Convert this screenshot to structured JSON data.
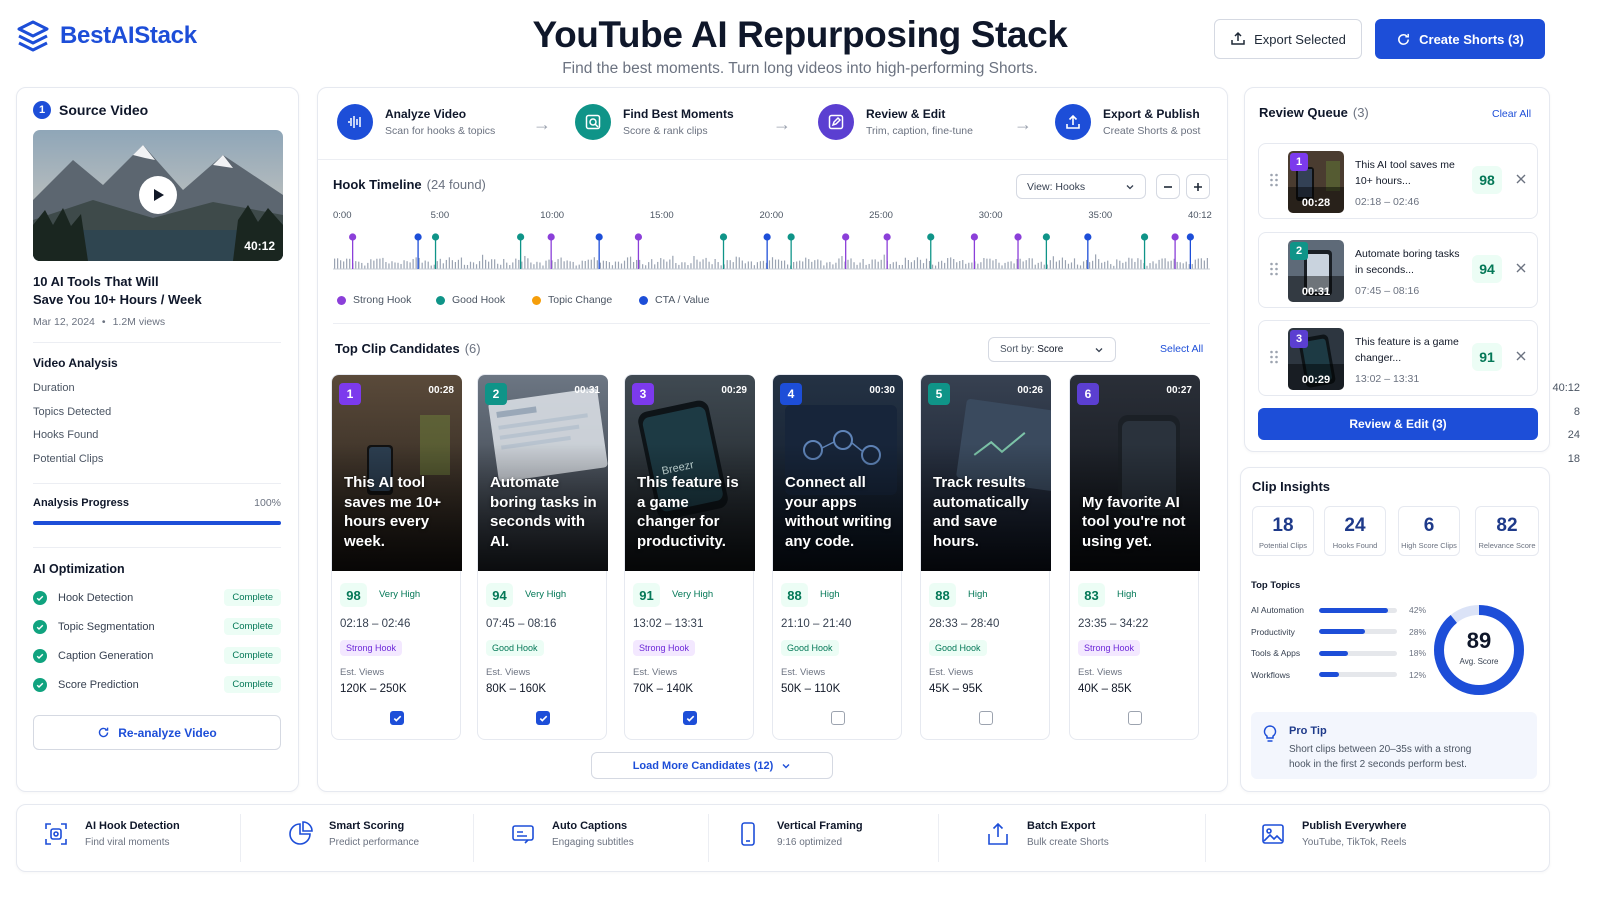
{
  "header": {
    "logo_text": "BestAIStack",
    "title": "YouTube AI Repurposing Stack",
    "subtitle": "Find the best moments. Turn long videos into high-performing Shorts.",
    "export_label": "Export Selected",
    "create_label": "Create Shorts (3)"
  },
  "source": {
    "step": "1",
    "heading": "Source Video",
    "duration_badge": "40:12",
    "video_title_1": "10 AI Tools That Will",
    "video_title_2": "Save You 10+ Hours / Week",
    "date": "Mar 12, 2024",
    "views": "1.2M views",
    "analysis_heading": "Video Analysis",
    "stats": [
      {
        "label": "Duration",
        "value": "40:12"
      },
      {
        "label": "Topics Detected",
        "value": "8"
      },
      {
        "label": "Hooks Found",
        "value": "24"
      },
      {
        "label": "Potential Clips",
        "value": "18"
      }
    ],
    "progress_label": "Analysis Progress",
    "progress_value": "100%",
    "progress_fraction": 1.0,
    "optimization_heading": "AI Optimization",
    "optimizations": [
      {
        "label": "Hook Detection",
        "status": "Complete"
      },
      {
        "label": "Topic Segmentation",
        "status": "Complete"
      },
      {
        "label": "Caption Generation",
        "status": "Complete"
      },
      {
        "label": "Score Prediction",
        "status": "Complete"
      }
    ],
    "reanalyze_label": "Re-analyze Video"
  },
  "pipeline": [
    {
      "title": "Analyze Video",
      "sub": "Scan for hooks & topics",
      "icon": "waveform-icon",
      "color": "#1d4ed8"
    },
    {
      "title": "Find Best Moments",
      "sub": "Score & rank clips",
      "icon": "target-icon",
      "color": "#0f9488"
    },
    {
      "title": "Review & Edit",
      "sub": "Trim, caption, fine-tune",
      "icon": "edit-icon",
      "color": "#5b3fd1"
    },
    {
      "title": "Export & Publish",
      "sub": "Create Shorts & post",
      "icon": "upload-icon",
      "color": "#1d4ed8"
    }
  ],
  "timeline": {
    "heading": "Hook Timeline",
    "found": "(24 found)",
    "view_label": "View: Hooks",
    "ticks": [
      "0:00",
      "5:00",
      "10:00",
      "15:00",
      "20:00",
      "25:00",
      "30:00",
      "35:00",
      "40:12"
    ],
    "total_minutes": 40.2,
    "markers": [
      {
        "t": 0.9,
        "type": "strong"
      },
      {
        "t": 3.9,
        "type": "cta"
      },
      {
        "t": 4.7,
        "type": "good"
      },
      {
        "t": 8.6,
        "type": "good"
      },
      {
        "t": 10.0,
        "type": "strong"
      },
      {
        "t": 12.2,
        "type": "cta"
      },
      {
        "t": 14.0,
        "type": "strong"
      },
      {
        "t": 17.9,
        "type": "good"
      },
      {
        "t": 19.9,
        "type": "cta"
      },
      {
        "t": 21.0,
        "type": "good"
      },
      {
        "t": 23.5,
        "type": "strong"
      },
      {
        "t": 25.4,
        "type": "strong"
      },
      {
        "t": 27.4,
        "type": "good"
      },
      {
        "t": 29.4,
        "type": "strong"
      },
      {
        "t": 31.4,
        "type": "strong"
      },
      {
        "t": 32.7,
        "type": "good"
      },
      {
        "t": 34.6,
        "type": "cta"
      },
      {
        "t": 37.2,
        "type": "good"
      },
      {
        "t": 38.6,
        "type": "strong"
      },
      {
        "t": 39.3,
        "type": "cta"
      }
    ],
    "legend": [
      {
        "label": "Strong Hook",
        "color": "#8b3fd9"
      },
      {
        "label": "Good Hook",
        "color": "#0f9488"
      },
      {
        "label": "Topic Change",
        "color": "#f59e0b"
      },
      {
        "label": "CTA / Value",
        "color": "#1d4ed8"
      }
    ],
    "colors": {
      "strong": "#8b3fd9",
      "good": "#0f9488",
      "topic": "#f59e0b",
      "cta": "#1d4ed8"
    }
  },
  "candidates": {
    "heading": "Top Clip Candidates",
    "count": "(6)",
    "sort_label": "Sort by:",
    "sort_value": "Score",
    "select_all": "Select All",
    "views_label": "Est. Views",
    "load_more": "Load More Candidates (12)",
    "items": [
      {
        "idx": "1",
        "dur": "00:28",
        "caption": "This AI tool saves me 10+ hours every week.",
        "score": "98",
        "quality": "Very High",
        "range": "02:18 – 02:46",
        "hook": "Strong Hook",
        "views": "120K – 250K",
        "checked": true,
        "idx_color": "#7c3aed"
      },
      {
        "idx": "2",
        "dur": "00:31",
        "caption": "Automate boring tasks in seconds with AI.",
        "score": "94",
        "quality": "Very High",
        "range": "07:45 – 08:16",
        "hook": "Good Hook",
        "views": "80K – 160K",
        "checked": true,
        "idx_color": "#0f9488"
      },
      {
        "idx": "3",
        "dur": "00:29",
        "caption": "This feature is a game changer for productivity.",
        "score": "91",
        "quality": "Very High",
        "range": "13:02 – 13:31",
        "hook": "Strong Hook",
        "views": "70K – 140K",
        "checked": true,
        "idx_color": "#7c3aed"
      },
      {
        "idx": "4",
        "dur": "00:30",
        "caption": "Connect all your apps without writing any code.",
        "score": "88",
        "quality": "High",
        "range": "21:10 – 21:40",
        "hook": "Good Hook",
        "views": "50K – 110K",
        "checked": false,
        "idx_color": "#1d4ed8"
      },
      {
        "idx": "5",
        "dur": "00:26",
        "caption": "Track results automatically and save hours.",
        "score": "88",
        "quality": "High",
        "range": "28:33 – 28:40",
        "hook": "Good Hook",
        "views": "45K – 95K",
        "checked": false,
        "idx_color": "#0f9488"
      },
      {
        "idx": "6",
        "dur": "00:27",
        "caption": "My favorite AI tool you're not using yet.",
        "score": "83",
        "quality": "High",
        "range": "23:35 – 34:22",
        "hook": "Strong Hook",
        "views": "40K – 85K",
        "checked": false,
        "idx_color": "#5b3fd1"
      }
    ]
  },
  "queue": {
    "heading": "Review Queue",
    "count": "(3)",
    "clear_all": "Clear All",
    "review_button": "Review & Edit (3)",
    "items": [
      {
        "idx": "1",
        "title": "This AI tool saves me 10+ hours...",
        "range": "02:18 – 02:46",
        "dur": "00:28",
        "score": "98",
        "idx_color": "#7c3aed"
      },
      {
        "idx": "2",
        "title": "Automate boring tasks in seconds...",
        "range": "07:45 – 08:16",
        "dur": "00:31",
        "score": "94",
        "idx_color": "#0f9488"
      },
      {
        "idx": "3",
        "title": "This feature is a game changer...",
        "range": "13:02 – 13:31",
        "dur": "00:29",
        "score": "91",
        "idx_color": "#5b3fd1"
      }
    ]
  },
  "insights": {
    "heading": "Clip Insights",
    "stats": [
      {
        "value": "18",
        "label": "Potential Clips"
      },
      {
        "value": "24",
        "label": "Hooks Found"
      },
      {
        "value": "6",
        "label": "High Score Clips"
      },
      {
        "value": "82",
        "label": "Relevance Score"
      }
    ],
    "topics_heading": "Top Topics",
    "topics": [
      {
        "name": "AI Automation",
        "pct": "42%",
        "value": 42
      },
      {
        "name": "Productivity",
        "pct": "28%",
        "value": 28
      },
      {
        "name": "Tools & Apps",
        "pct": "18%",
        "value": 18
      },
      {
        "name": "Workflows",
        "pct": "12%",
        "value": 12
      }
    ],
    "avg_score": "89",
    "avg_label": "Avg. Score",
    "avg_fraction": 0.89,
    "tip_title": "Pro Tip",
    "tip_line1": "Short clips between 20–35s with a strong",
    "tip_line2": "hook in the first 2 seconds perform best."
  },
  "features": [
    {
      "title": "AI Hook Detection",
      "sub": "Find viral moments",
      "icon": "hook-scan-icon"
    },
    {
      "title": "Smart Scoring",
      "sub": "Predict performance",
      "icon": "pie-chart-icon"
    },
    {
      "title": "Auto Captions",
      "sub": "Engaging subtitles",
      "icon": "captions-icon"
    },
    {
      "title": "Vertical Framing",
      "sub": "9:16 optimized",
      "icon": "phone-icon"
    },
    {
      "title": "Batch Export",
      "sub": "Bulk create Shorts",
      "icon": "export-icon"
    },
    {
      "title": "Publish Everywhere",
      "sub": "YouTube, TikTok, Reels",
      "icon": "image-icon"
    }
  ]
}
